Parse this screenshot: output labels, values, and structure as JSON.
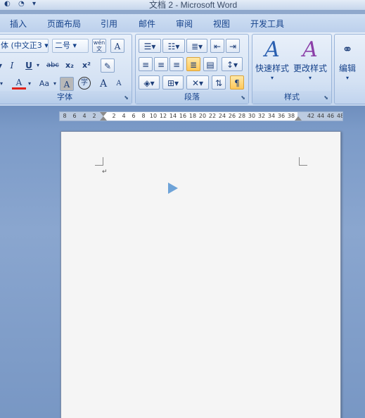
{
  "window": {
    "title": "文档 2 - Microsoft Word"
  },
  "tabs": [
    "插入",
    "页面布局",
    "引用",
    "邮件",
    "审阅",
    "视图",
    "开发工具"
  ],
  "font_group": {
    "font_name": "体 (中文正3",
    "font_size": "二号",
    "label": "字体",
    "buttons": {
      "wen": "wén文",
      "a_box": "A",
      "italic": "I",
      "underline": "U",
      "strike": "abc",
      "subscript": "x₂",
      "superscript": "x²",
      "font_color": "A",
      "case": "Aa",
      "char_shading": "A",
      "enclose": "字",
      "grow": "A",
      "shrink": "A"
    }
  },
  "paragraph_group": {
    "label": "段落"
  },
  "styles_group": {
    "label": "样式",
    "quick_styles": "快速样式",
    "change_styles": "更改样式"
  },
  "editing_group": {
    "label": "编辑"
  },
  "ruler": {
    "ticks": [
      "8",
      "6",
      "4",
      "2",
      "",
      "2",
      "4",
      "6",
      "8",
      "10",
      "12",
      "14",
      "16",
      "18",
      "20",
      "22",
      "24",
      "26",
      "28",
      "30",
      "32",
      "34",
      "36",
      "38",
      "",
      "42",
      "44",
      "46",
      "48"
    ]
  },
  "document": {
    "paragraph_mark": "↵"
  },
  "colors": {
    "accent": "#15428b",
    "highlight": "#ffc85a",
    "font_color_bar": "#e2231a"
  }
}
